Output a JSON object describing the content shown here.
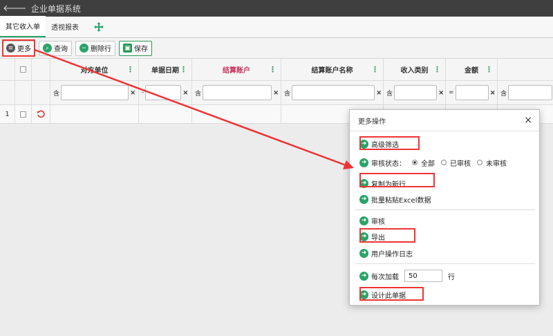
{
  "app": {
    "title": "企业单据系统",
    "back_icon": "back-arrow-icon"
  },
  "tabs": [
    {
      "label": "其它收入单",
      "active": true
    },
    {
      "label": "透视报表",
      "active": false
    }
  ],
  "toolbar": {
    "more": "更多",
    "query": "查询",
    "delete_row": "删除行",
    "save": "保存"
  },
  "grid": {
    "headers": [
      "对方单位",
      "单据日期",
      "结算账户",
      "结算账户名称",
      "收入类别",
      "金额"
    ],
    "filter_ops": [
      "含",
      "-",
      "含",
      "含",
      "含",
      "="
    ],
    "clear_label": "×",
    "rows": [
      {
        "num": "1"
      }
    ]
  },
  "dialog": {
    "title": "更多操作",
    "close": "×",
    "advanced_filter": "高级筛选",
    "audit_status_label": "审核状态：",
    "audit_options": [
      "全部",
      "已审核",
      "未审核"
    ],
    "audit_selected": "全部",
    "copy_new_row": "复制为新行",
    "batch_paste": "批量粘贴Excel数据",
    "audit": "审核",
    "export": "导出",
    "user_log": "用户操作日志",
    "load_label": "每次加载",
    "load_value": "50",
    "load_unit": "行",
    "design": "设计此单据"
  },
  "colors": {
    "accent_green": "#2aa368",
    "highlight_red": "#ee3333",
    "titlebar": "#3f3f3f"
  }
}
